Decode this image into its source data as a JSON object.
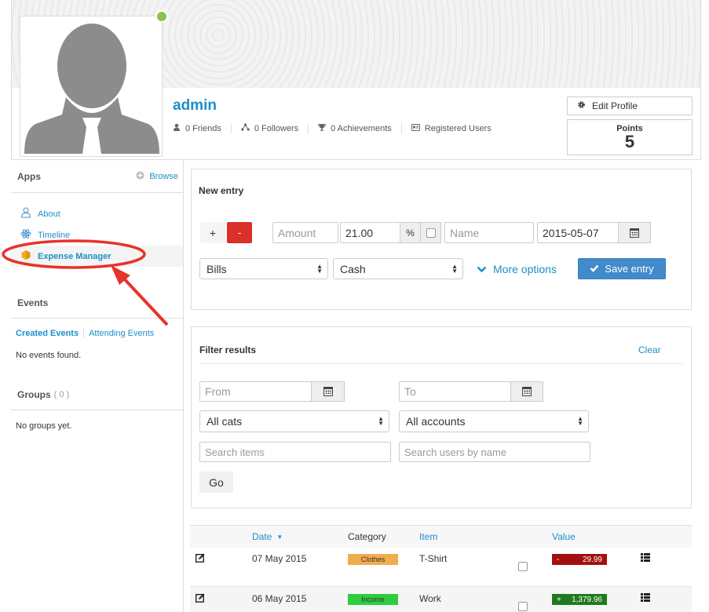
{
  "profile": {
    "username": "admin",
    "stats": [
      {
        "icon": "user-icon",
        "label": "0 Friends"
      },
      {
        "icon": "share-icon",
        "label": "0 Followers"
      },
      {
        "icon": "trophy-icon",
        "label": "0 Achievements"
      },
      {
        "icon": "id-card-icon",
        "label": "Registered Users"
      }
    ],
    "edit_label": "Edit Profile",
    "points_label": "Points",
    "points_value": "5",
    "online_color": "#8bc34a"
  },
  "sidebar": {
    "apps_title": "Apps",
    "browse_label": "Browse",
    "apps": [
      {
        "label": "About",
        "icon": "user-icon"
      },
      {
        "label": "Timeline",
        "icon": "atom-icon"
      },
      {
        "label": "Expense Manager",
        "icon": "hexagon-icon"
      }
    ],
    "events_title": "Events",
    "event_tabs": [
      "Created Events",
      "Attending Events"
    ],
    "events_empty": "No events found.",
    "groups_title": "Groups",
    "groups_count": "( 0 )",
    "groups_empty": "No groups yet."
  },
  "new_entry": {
    "title": "New entry",
    "plus": "+",
    "minus": "-",
    "amount_placeholder": "Amount",
    "percent_value": "21.00",
    "percent_sign": "%",
    "name_placeholder": "Name",
    "date_value": "2015-05-07",
    "category_value": "Bills",
    "account_value": "Cash",
    "more_options": "More options",
    "save_label": "Save entry"
  },
  "filter": {
    "title": "Filter results",
    "clear_label": "Clear",
    "from_placeholder": "From",
    "to_placeholder": "To",
    "cats_value": "All cats",
    "accounts_value": "All accounts",
    "search_items_placeholder": "Search items",
    "search_users_placeholder": "Search users by name",
    "go_label": "Go"
  },
  "table": {
    "headers": {
      "date": "Date",
      "category": "Category",
      "item": "Item",
      "value": "Value"
    },
    "rows": [
      {
        "date": "07 May 2015",
        "category": "Clothes",
        "category_color": "#f0ad4e",
        "item": "T-Shirt",
        "sign": "-",
        "value": "29.99",
        "value_color": "#a30f0f"
      },
      {
        "date": "06 May 2015",
        "category": "Income",
        "category_color": "#2ecc40",
        "item": "Work",
        "sign": "+",
        "value": "1,379.96",
        "value_color": "#1e7a1e"
      }
    ]
  },
  "colors": {
    "accent": "#1c8fc9",
    "primary_button": "#428bca",
    "danger": "#d9302c",
    "annotation": "#e8322a"
  }
}
